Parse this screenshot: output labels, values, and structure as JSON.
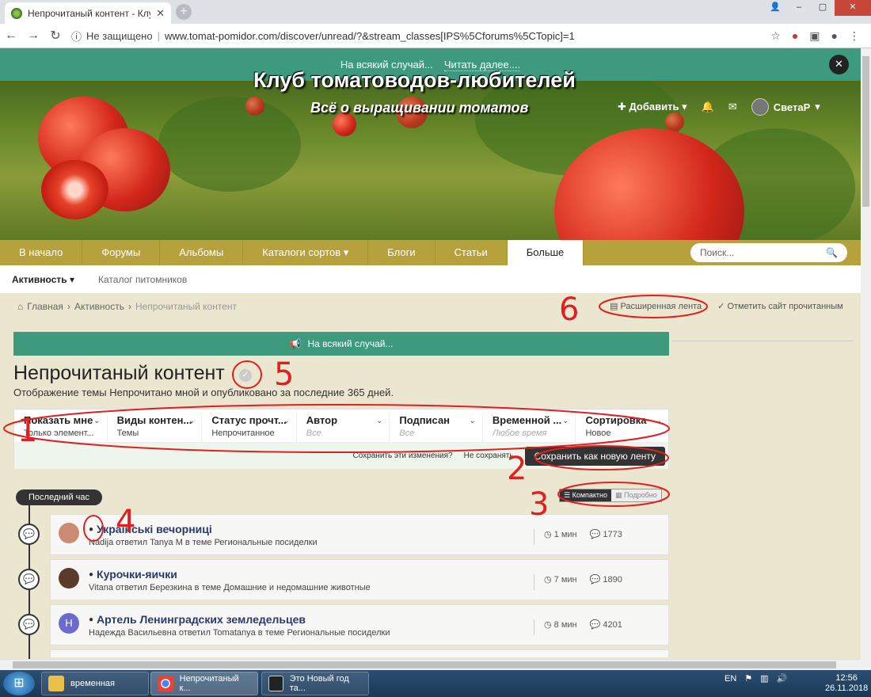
{
  "browser": {
    "tab_title": "Непрочитаный контент - Клуб т",
    "url": "www.tomat-pomidor.com/discover/unread/?&stream_classes[IPS%5Cforums%5CTopic]=1",
    "security": "Не защищено"
  },
  "announcement": {
    "text": "На всякий случай...",
    "link": "Читать далее...."
  },
  "header": {
    "title": "Клуб томатоводов-любителей",
    "subtitle": "Всё о выращивании томатов",
    "add": "Добавить",
    "user": "СветаР"
  },
  "nav": {
    "items": [
      "В начало",
      "Форумы",
      "Альбомы",
      "Каталоги сортов",
      "Блоги",
      "Статьи",
      "Больше"
    ],
    "search_placeholder": "Поиск..."
  },
  "subnav": {
    "active": "Активность",
    "other": "Каталог питомников"
  },
  "breadcrumb": {
    "home": "Главная",
    "activity": "Активность",
    "current": "Непрочитаный контент"
  },
  "right_links": {
    "feed": "Расширенная лента",
    "mark_read": "Отметить сайт прочитанным"
  },
  "ann_bar": "На всякий случай...",
  "page": {
    "title": "Непрочитаный контент",
    "desc": "Отображение темы Непрочитано мной и опубликовано за последние 365 дней."
  },
  "filters": [
    {
      "t": "Показать мне",
      "v": "Только элемент..."
    },
    {
      "t": "Виды контен...",
      "v": "Темы"
    },
    {
      "t": "Статус прочт...",
      "v": "Непрочитанное"
    },
    {
      "t": "Автор",
      "v": "Все"
    },
    {
      "t": "Подписан",
      "v": "Все"
    },
    {
      "t": "Временной ...",
      "v": "Любое время"
    },
    {
      "t": "Сортировка",
      "v": "Новое"
    }
  ],
  "save": {
    "q": "Сохранить эти изменения?",
    "no": "Не сохранять",
    "btn": "Сохранить как новую ленту"
  },
  "timeline": {
    "pill": "Последний час",
    "compact": "Компактно",
    "detailed": "Подробно"
  },
  "rows": [
    {
      "title": "Українські вечорниці",
      "sub": "Nadija ответил Tanya M в теме Региональные посиделки",
      "time": "1 мин",
      "count": "1773"
    },
    {
      "title": "Курочки-яички",
      "sub": "Vitana ответил Березкина в теме Домашние и недомашние животные",
      "time": "7 мин",
      "count": "1890"
    },
    {
      "title": "Артель Ленинградских земледельцев",
      "sub": "Надежда Васильевна ответил Tomatanya в теме Региональные посиделки",
      "time": "8 мин",
      "count": "4201"
    }
  ],
  "taskbar": {
    "items": [
      "временная",
      "Непрочитаный к...",
      "Это Новый год та..."
    ],
    "lang": "EN",
    "time": "12:56",
    "date": "26.11.2018"
  },
  "annotations": [
    "1",
    "2",
    "3",
    "4",
    "5",
    "6"
  ]
}
